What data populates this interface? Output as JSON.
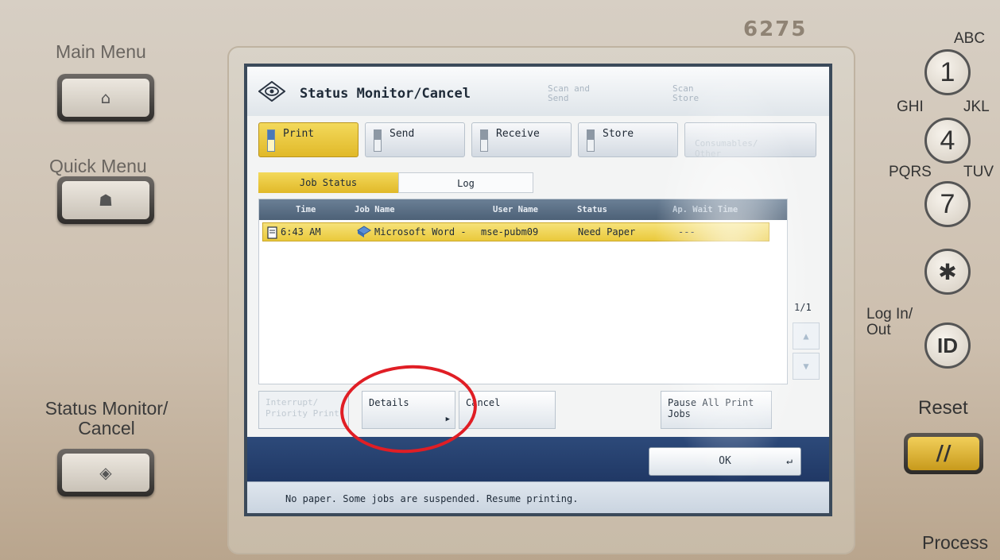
{
  "device": {
    "model": "6275",
    "left_labels": {
      "main_menu": "Main Menu",
      "quick_menu": "Quick Menu",
      "status_monitor": "Status Monitor/\nCancel"
    },
    "keypad": {
      "keys": [
        {
          "label": "1",
          "letters": "ABC"
        },
        {
          "label": "4",
          "letters": "GHI"
        },
        {
          "label": "7",
          "letters": "PQRS"
        },
        {
          "label": "✱",
          "letters": ""
        }
      ],
      "side_letters": [
        "JKL",
        "TUV"
      ],
      "login_label": "Log In/\nOut",
      "login_key": "ID",
      "reset_label": "Reset",
      "reset_key": "//",
      "process_label": "Process"
    }
  },
  "screen": {
    "title": "Status Monitor/Cancel",
    "ghost_buttons": [
      "Scan and\nSend",
      "Scan\nStore"
    ],
    "tabs": [
      {
        "label": "Print",
        "active": true,
        "enabled": true
      },
      {
        "label": "Send",
        "active": false,
        "enabled": true
      },
      {
        "label": "Receive",
        "active": false,
        "enabled": true
      },
      {
        "label": "Store",
        "active": false,
        "enabled": true
      },
      {
        "label": "Consumables/\nOther",
        "active": false,
        "enabled": false
      }
    ],
    "subtabs": [
      {
        "label": "Job Status",
        "active": true
      },
      {
        "label": "Log",
        "active": false
      }
    ],
    "columns": [
      "Time",
      "Job Name",
      "User Name",
      "Status",
      "Ap. Wait Time"
    ],
    "rows": [
      {
        "time": "6:43 AM",
        "job_name": "Microsoft Word -",
        "user_name": "mse-pubm09",
        "status": "Need Paper",
        "wait": "---"
      }
    ],
    "pager": "1/1",
    "actions": {
      "interrupt": "Interrupt/\nPriority Print",
      "details": "Details",
      "cancel": "Cancel",
      "pause": "Pause All Print\nJobs"
    },
    "ok": "OK",
    "status_message": "No paper. Some jobs are suspended. Resume printing."
  },
  "colors": {
    "accent_yellow": "#e1b929",
    "header_blue": "#4d6177",
    "bottom_bar_blue": "#203865",
    "annotation_red": "#e01e25"
  }
}
